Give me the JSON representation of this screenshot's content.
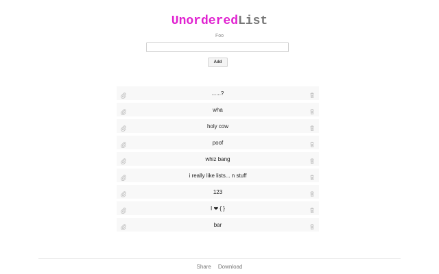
{
  "header": {
    "title_part1": "Unordered",
    "title_part2": "List",
    "title_color_part1": "#e020d0",
    "title_color_part2": "#777777"
  },
  "form": {
    "label": "Foo",
    "input_value": "",
    "add_label": "Add"
  },
  "list": {
    "items": [
      {
        "text": "......?"
      },
      {
        "text": "wha"
      },
      {
        "text": "holy cow"
      },
      {
        "text": "poof"
      },
      {
        "text": "whiz bang"
      },
      {
        "text": "i really like lists... n stuff"
      },
      {
        "text": "123"
      },
      {
        "text": "I ❤ { }"
      },
      {
        "text": "bar"
      }
    ],
    "item_icons": {
      "left": "paperclip-icon",
      "right": "trash-icon"
    }
  },
  "footer": {
    "share_label": "Share",
    "download_label": "Download"
  }
}
